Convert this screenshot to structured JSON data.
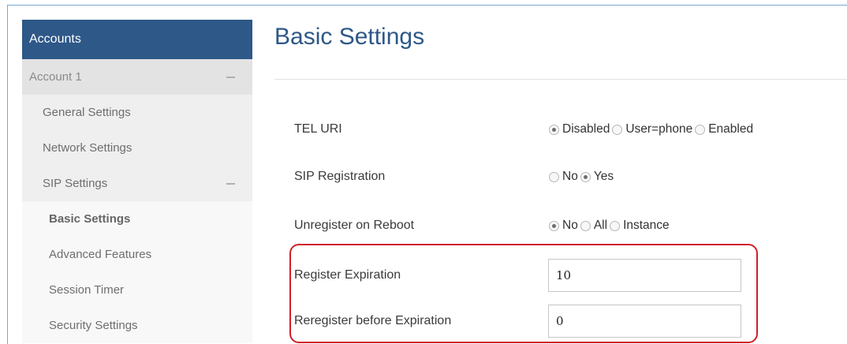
{
  "sidebar": {
    "header": "Accounts",
    "account": "Account 1",
    "items": [
      {
        "label": "General Settings"
      },
      {
        "label": "Network Settings"
      },
      {
        "label": "SIP Settings"
      }
    ],
    "sip_sub_items": [
      {
        "label": "Basic Settings"
      },
      {
        "label": "Advanced Features"
      },
      {
        "label": "Session Timer"
      },
      {
        "label": "Security Settings"
      }
    ]
  },
  "main": {
    "title": "Basic Settings",
    "tel_uri": {
      "label": "TEL URI",
      "options": [
        "Disabled",
        "User=phone",
        "Enabled"
      ],
      "selected": "Disabled"
    },
    "sip_registration": {
      "label": "SIP Registration",
      "options": [
        "No",
        "Yes"
      ],
      "selected": "Yes"
    },
    "unregister_on_reboot": {
      "label": "Unregister on Reboot",
      "options": [
        "No",
        "All",
        "Instance"
      ],
      "selected": "No"
    },
    "register_expiration": {
      "label": "Register Expiration",
      "value": "10"
    },
    "reregister_before_expiration": {
      "label": "Reregister before Expiration",
      "value": "0"
    }
  },
  "colors": {
    "header_bg": "#2e5888",
    "title": "#2e5888",
    "highlight": "#d0202a"
  }
}
